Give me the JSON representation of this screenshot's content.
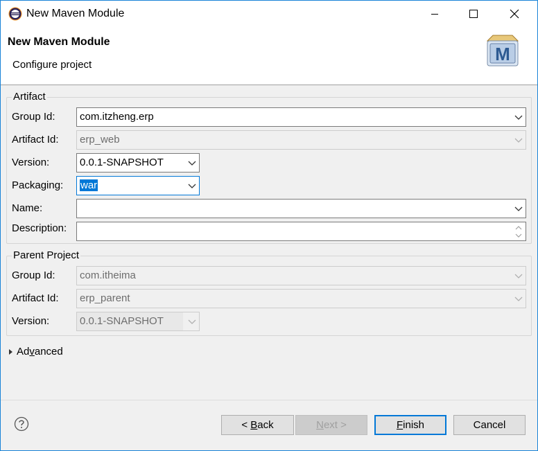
{
  "window": {
    "title": "New Maven Module",
    "icon": "eclipse-icon"
  },
  "header": {
    "title": "New Maven Module",
    "subtitle": "Configure project",
    "banner_letter": "M"
  },
  "artifact": {
    "legend": "Artifact",
    "group_id": {
      "label": "Group Id:",
      "value": "com.itzheng.erp"
    },
    "artifact_id": {
      "label": "Artifact Id:",
      "value": "erp_web"
    },
    "version": {
      "label": "Version:",
      "value": "0.0.1-SNAPSHOT"
    },
    "packaging": {
      "label": "Packaging:",
      "value": "war"
    },
    "name": {
      "label": "Name:",
      "value": ""
    },
    "description": {
      "label": "Description:",
      "value": ""
    }
  },
  "parent": {
    "legend": "Parent Project",
    "group_id": {
      "label": "Group Id:",
      "value": "com.itheima"
    },
    "artifact_id": {
      "label": "Artifact Id:",
      "value": "erp_parent"
    },
    "version": {
      "label": "Version:",
      "value": "0.0.1-SNAPSHOT"
    }
  },
  "advanced": {
    "label_prefix": "Ad",
    "label_mnemonic": "v",
    "label_suffix": "anced"
  },
  "buttons": {
    "back": {
      "prefix": "< ",
      "mnemonic": "B",
      "suffix": "ack"
    },
    "next": {
      "mnemonic": "N",
      "suffix": "ext >"
    },
    "finish": {
      "mnemonic": "F",
      "suffix": "inish"
    },
    "cancel": "Cancel"
  },
  "colors": {
    "accent": "#0078d7",
    "window_border": "#1883d7"
  }
}
